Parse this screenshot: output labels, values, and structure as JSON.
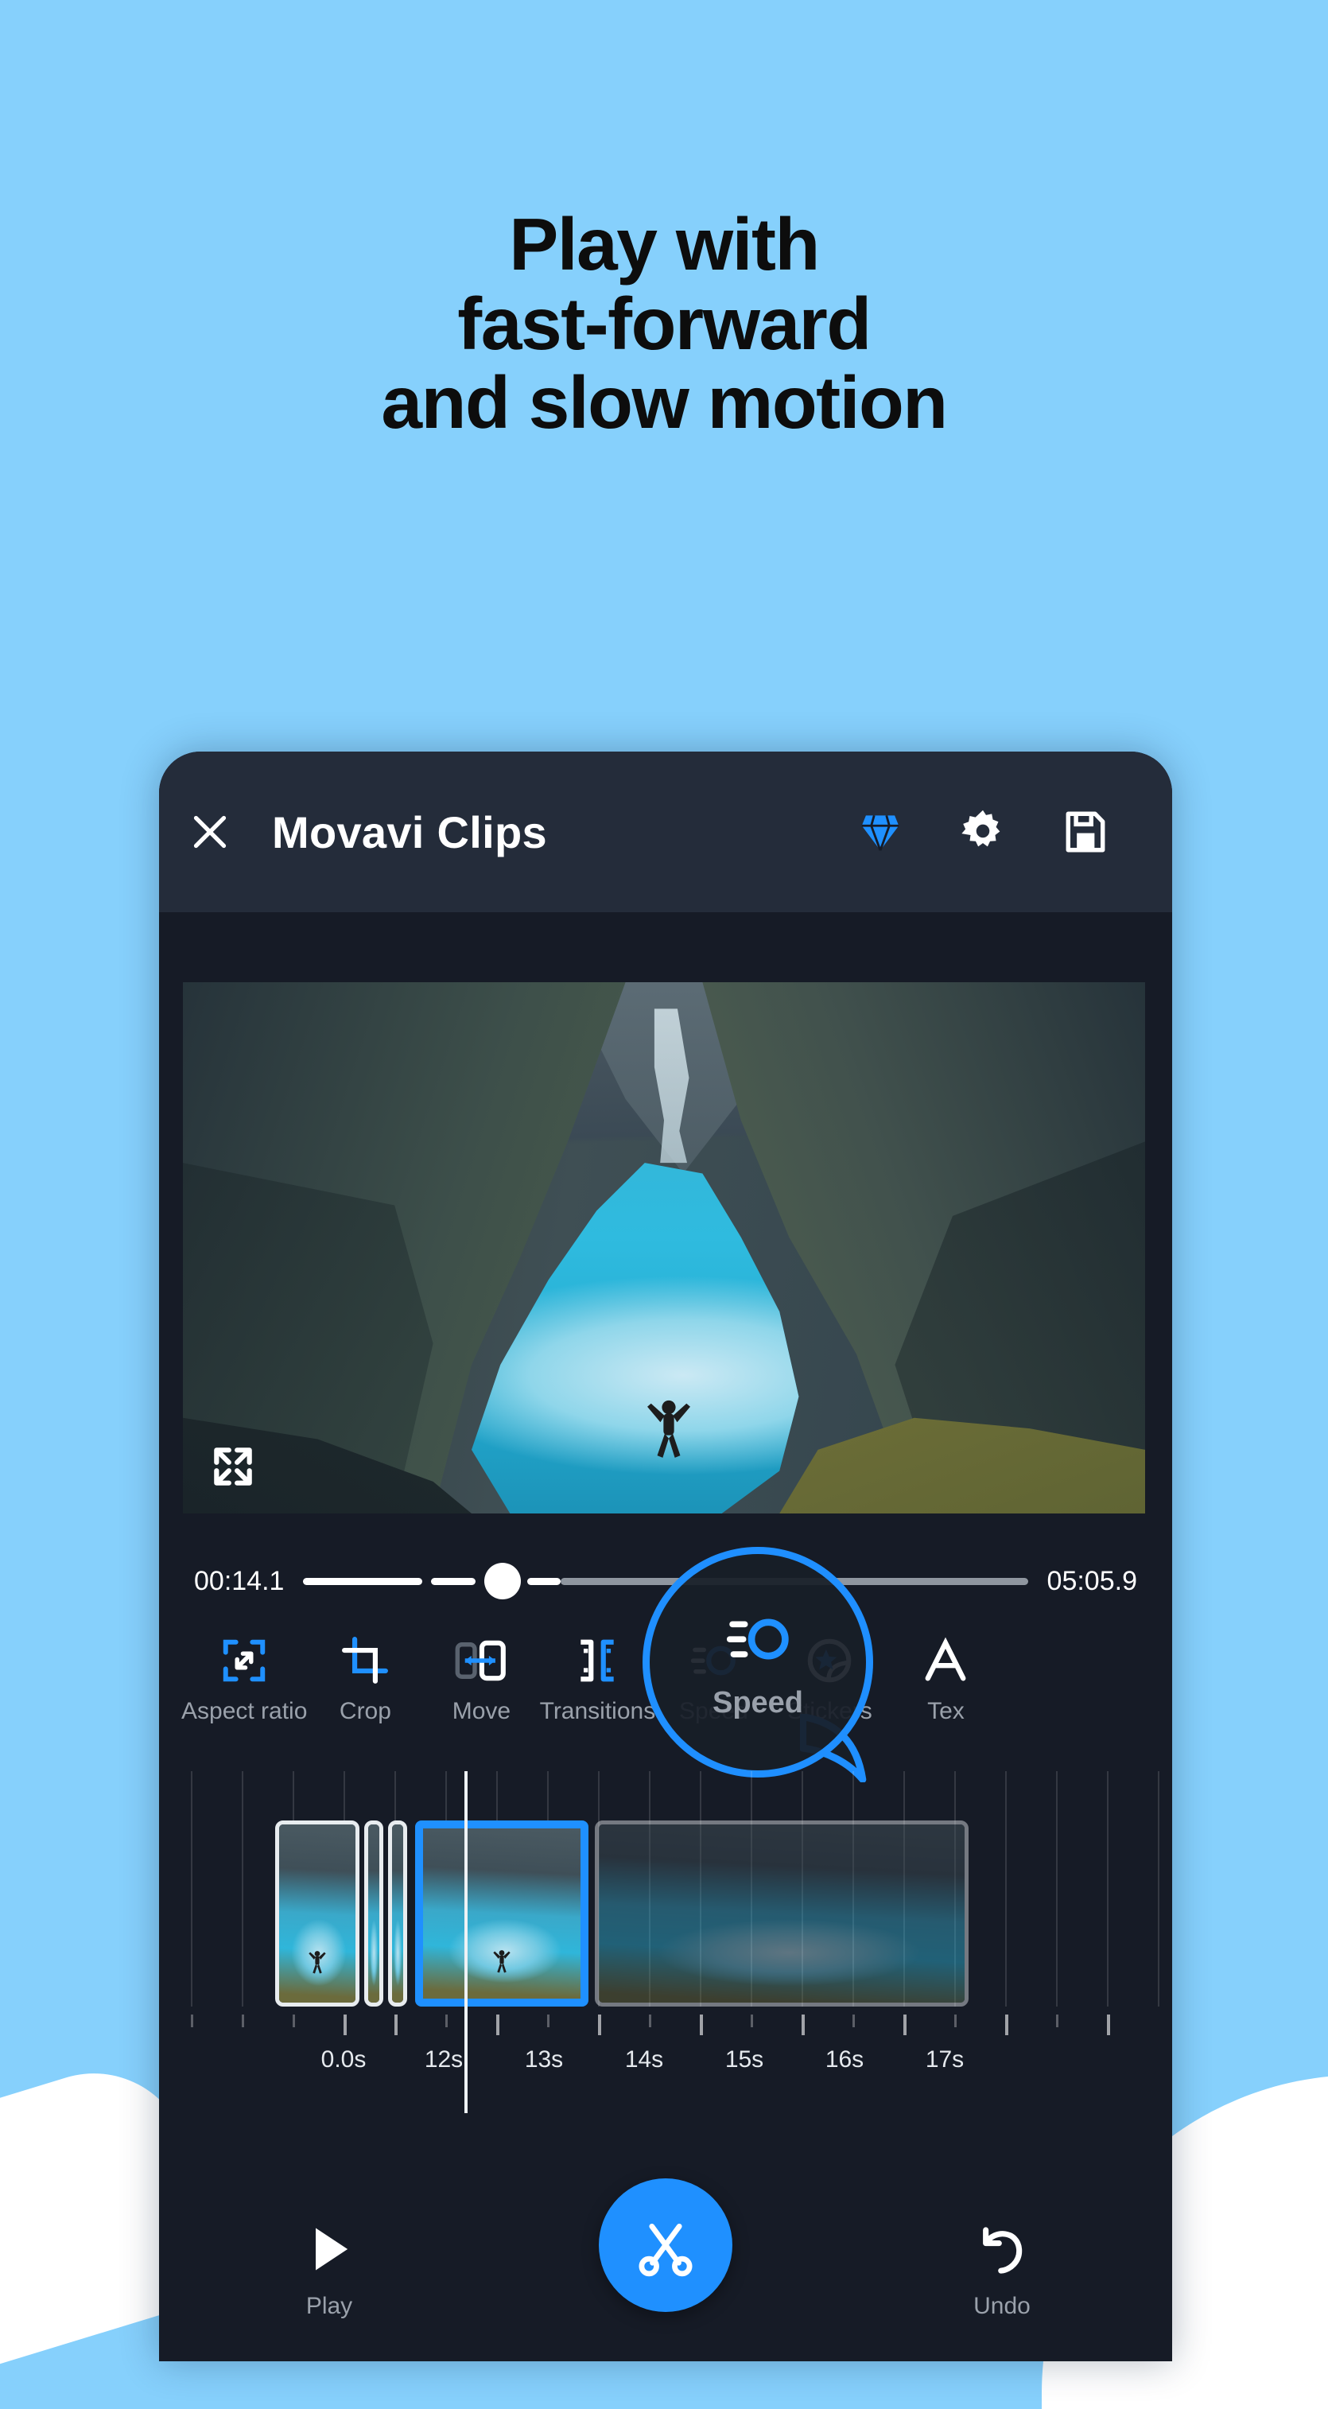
{
  "background_color": "#86d0fc",
  "accent_color": "#1f90ff",
  "headline": {
    "line1": "Play with",
    "line2": "fast-forward",
    "line3": "and slow motion"
  },
  "app": {
    "title": "Movavi Clips",
    "header": {
      "close_icon": "close-icon",
      "premium_icon": "diamond-icon",
      "settings_icon": "gear-icon",
      "save_icon": "save-icon"
    },
    "preview": {
      "fullscreen_icon": "fullscreen-icon",
      "scene": "aerial view of turquoise alpine lake in a valley with a person jumping"
    },
    "scrubber": {
      "current_time": "00:14.1",
      "total_time": "05:05.9",
      "handle_position_pct": 27.5
    },
    "tools": [
      {
        "label": "Aspect ratio",
        "icon": "aspect-ratio-icon"
      },
      {
        "label": "Crop",
        "icon": "crop-icon"
      },
      {
        "label": "Move",
        "icon": "move-icon"
      },
      {
        "label": "Transitions",
        "icon": "transitions-icon"
      },
      {
        "label": "Speed",
        "icon": "speed-icon"
      },
      {
        "label": "Stickers",
        "icon": "stickers-icon"
      },
      {
        "label": "Tex",
        "icon": "text-icon"
      }
    ],
    "callout": {
      "label": "Speed",
      "icon": "speed-icon",
      "border_color": "#1f90ff"
    },
    "timeline": {
      "ruler_labels": [
        "0.0s",
        "12s",
        "13s",
        "14s",
        "15s",
        "16s",
        "17s"
      ],
      "clips": [
        {
          "name": "clip-1",
          "selected": false,
          "dim": false
        },
        {
          "name": "clip-2",
          "selected": false,
          "dim": false
        },
        {
          "name": "clip-3",
          "selected": false,
          "dim": false
        },
        {
          "name": "clip-4",
          "selected": true,
          "dim": false
        },
        {
          "name": "clip-5",
          "selected": false,
          "dim": true
        }
      ]
    },
    "bottom_bar": {
      "play_label": "Play",
      "play_icon": "play-icon",
      "cut_icon": "scissors-icon",
      "undo_label": "Undo",
      "undo_icon": "undo-icon"
    }
  }
}
